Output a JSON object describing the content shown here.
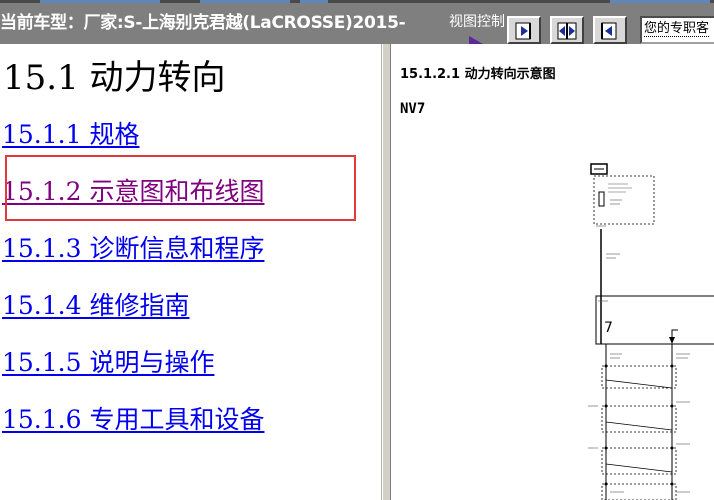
{
  "header": {
    "model_title": "当前车型：厂家:S-上海别克君越(LaCROSSE)2015-",
    "view_control_label": "视图控制",
    "search_text": "您的专职客"
  },
  "toc": {
    "title": "15.1 动力转向",
    "items": [
      {
        "label": "15.1.1 规格",
        "visited": false
      },
      {
        "label": "15.1.2 示意图和布线图",
        "visited": true
      },
      {
        "label": "15.1.3 诊断信息和程序",
        "visited": false
      },
      {
        "label": "15.1.4 维修指南",
        "visited": false
      },
      {
        "label": "15.1.5 说明与操作",
        "visited": false
      },
      {
        "label": "15.1.6 专用工具和设备",
        "visited": false
      }
    ],
    "selected_item_index": 1
  },
  "content": {
    "section_heading": "15.1.2.1 动力转向示意图",
    "diagram_code": "NV7"
  },
  "icons": [
    "next-page-icon",
    "expand-icon",
    "previous-page-icon",
    "view-control-arrow-icon"
  ],
  "colors": {
    "link": "#0000ee",
    "visited_link": "#800080",
    "highlight_border": "#e03a3a",
    "toolbar_background": "#7f7f7f"
  }
}
